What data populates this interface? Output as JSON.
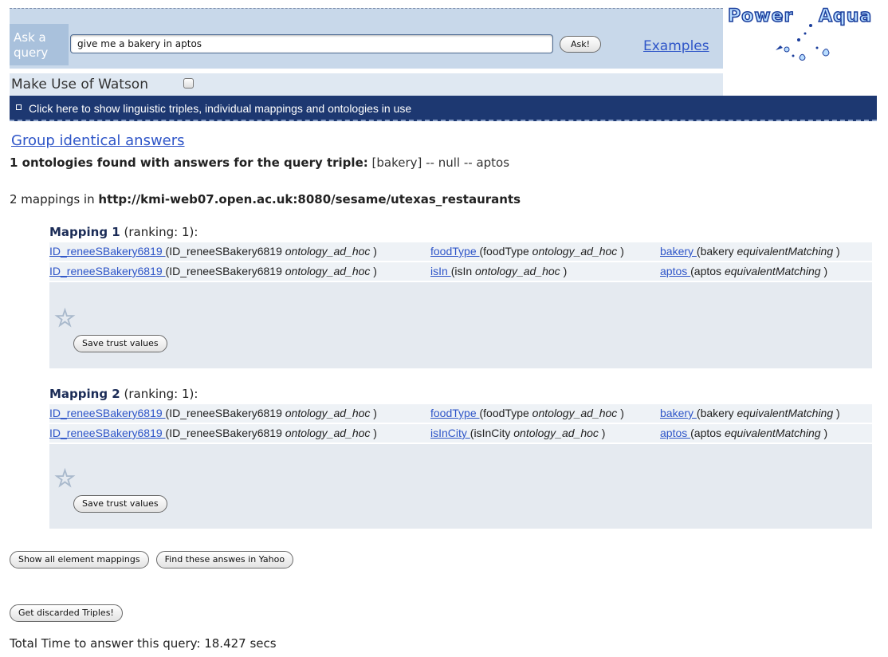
{
  "header": {
    "ask_label": "Ask a query",
    "query_value": "give me a bakery in aptos",
    "ask_button": "Ask!",
    "examples_link": "Examples",
    "logo_text_left": "Power",
    "logo_text_right": "Aqua",
    "watson_label": "Make Use of Watson",
    "triples_bar_text": "Click here to show linguistic triples, individual mappings and ontologies in use"
  },
  "results": {
    "group_link": "Group identical answers",
    "found_bold": "1 ontologies found with answers for the query triple:",
    "found_triple": "[bakery] -- null -- aptos",
    "mappings_count_text": "2 mappings in",
    "mappings_source": "http://kmi-web07.open.ac.uk:8080/sesame/utexas_restaurants"
  },
  "mappings": [
    {
      "title": "Mapping 1",
      "ranking": "(ranking: 1):",
      "rows": [
        {
          "subject_link": "ID_reneeSBakery6819 ",
          "subject_text": "(ID_reneeSBakery6819 ",
          "subject_ont": "ontology_ad_hoc",
          "pred_link": "foodType ",
          "pred_text": "(foodType ",
          "pred_ont": "ontology_ad_hoc",
          "obj_link": "bakery ",
          "obj_text": "(bakery ",
          "obj_match": "equivalentMatching"
        },
        {
          "subject_link": "ID_reneeSBakery6819 ",
          "subject_text": "(ID_reneeSBakery6819 ",
          "subject_ont": "ontology_ad_hoc",
          "pred_link": "isIn ",
          "pred_text": "(isIn ",
          "pred_ont": "ontology_ad_hoc",
          "obj_link": "aptos ",
          "obj_text": "(aptos ",
          "obj_match": "equivalentMatching"
        }
      ],
      "save_button": "Save trust values"
    },
    {
      "title": "Mapping 2",
      "ranking": "(ranking: 1):",
      "rows": [
        {
          "subject_link": "ID_reneeSBakery6819 ",
          "subject_text": "(ID_reneeSBakery6819 ",
          "subject_ont": "ontology_ad_hoc",
          "pred_link": "foodType ",
          "pred_text": "(foodType ",
          "pred_ont": "ontology_ad_hoc",
          "obj_link": "bakery ",
          "obj_text": "(bakery ",
          "obj_match": "equivalentMatching"
        },
        {
          "subject_link": "ID_reneeSBakery6819 ",
          "subject_text": "(ID_reneeSBakery6819 ",
          "subject_ont": "ontology_ad_hoc",
          "pred_link": "isInCity ",
          "pred_text": "(isInCity ",
          "pred_ont": "ontology_ad_hoc",
          "obj_link": "aptos ",
          "obj_text": "(aptos ",
          "obj_match": "equivalentMatching"
        }
      ],
      "save_button": "Save trust values"
    }
  ],
  "footer": {
    "show_all_button": "Show all element mappings",
    "yahoo_button": "Find these answes in Yahoo",
    "discarded_button": "Get discarded Triples!",
    "total_time": "Total Time to answer this query: 18.427 secs"
  }
}
